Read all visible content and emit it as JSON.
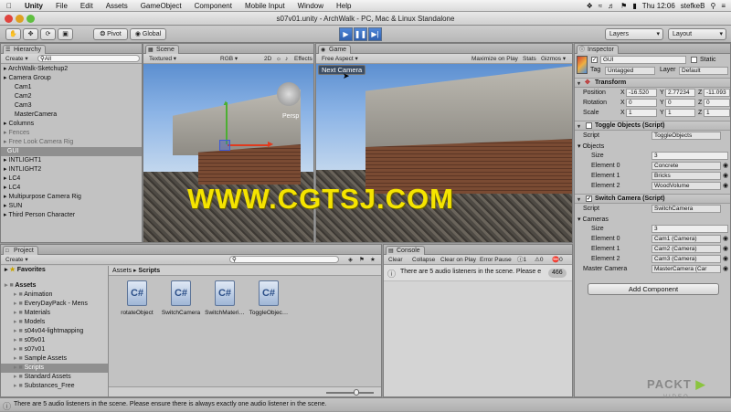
{
  "menubar": {
    "app": "Unity",
    "items": [
      "File",
      "Edit",
      "Assets",
      "GameObject",
      "Component",
      "Mobile Input",
      "Window",
      "Help"
    ],
    "clock": "Thu 12:06",
    "user": "stefkeB"
  },
  "window": {
    "title": "s07v01.unity - ArchWalk - PC, Mac & Linux Standalone"
  },
  "toolbar": {
    "pivot": "Pivot",
    "global": "Global",
    "layers": "Layers",
    "layout": "Layout"
  },
  "hierarchy": {
    "tab": "Hierarchy",
    "create": "Create",
    "search_all": "All",
    "items": [
      {
        "label": "ArchWalk-Sketchup2",
        "indent": 0,
        "arrow": true,
        "state": "normal"
      },
      {
        "label": "Camera Group",
        "indent": 0,
        "arrow": true,
        "state": "normal"
      },
      {
        "label": "Cam1",
        "indent": 1,
        "arrow": false,
        "state": "normal"
      },
      {
        "label": "Cam2",
        "indent": 1,
        "arrow": false,
        "state": "normal"
      },
      {
        "label": "Cam3",
        "indent": 1,
        "arrow": false,
        "state": "normal"
      },
      {
        "label": "MasterCamera",
        "indent": 1,
        "arrow": false,
        "state": "normal"
      },
      {
        "label": "Columns",
        "indent": 0,
        "arrow": true,
        "state": "normal"
      },
      {
        "label": "Fences",
        "indent": 0,
        "arrow": true,
        "state": "muted"
      },
      {
        "label": "Free Look Camera Rig",
        "indent": 0,
        "arrow": true,
        "state": "muted"
      },
      {
        "label": "GUI",
        "indent": 0,
        "arrow": false,
        "state": "selected"
      },
      {
        "label": "INTLIGHT1",
        "indent": 0,
        "arrow": true,
        "state": "normal"
      },
      {
        "label": "INTLIGHT2",
        "indent": 0,
        "arrow": true,
        "state": "normal"
      },
      {
        "label": "LC4",
        "indent": 0,
        "arrow": true,
        "state": "normal"
      },
      {
        "label": "LC4",
        "indent": 0,
        "arrow": true,
        "state": "normal"
      },
      {
        "label": "Multipurpose Camera Rig",
        "indent": 0,
        "arrow": true,
        "state": "normal"
      },
      {
        "label": "SUN",
        "indent": 0,
        "arrow": true,
        "state": "normal"
      },
      {
        "label": "Third Person Character",
        "indent": 0,
        "arrow": true,
        "state": "normal"
      }
    ]
  },
  "scene": {
    "tab": "Scene",
    "shading": "Textured",
    "render": "RGB",
    "mode2d": "2D",
    "effects": "Effects",
    "persp": "Persp"
  },
  "game": {
    "tab": "Game",
    "aspect": "Free Aspect",
    "maximize": "Maximize on Play",
    "stats": "Stats",
    "gizmos": "Gizmos",
    "button": "Next Camera"
  },
  "watermark": "WWW.CGTSJ.COM",
  "inspector": {
    "tab": "Inspector",
    "object_name": "GUI",
    "static": "Static",
    "tag_label": "Tag",
    "tag": "Untagged",
    "layer_label": "Layer",
    "layer": "Default",
    "transform": {
      "title": "Transform",
      "position": {
        "label": "Position",
        "x": "-16.520",
        "y": "2.77234",
        "z": "-11.093"
      },
      "rotation": {
        "label": "Rotation",
        "x": "0",
        "y": "0",
        "z": "0"
      },
      "scale": {
        "label": "Scale",
        "x": "1",
        "y": "1",
        "z": "1"
      }
    },
    "toggle": {
      "title": "Toggle Objects (Script)",
      "script_label": "Script",
      "script": "ToggleObjects",
      "list_label": "Objects",
      "size_label": "Size",
      "size": "3",
      "elements": [
        {
          "label": "Element 0",
          "value": "Concrete"
        },
        {
          "label": "Element 1",
          "value": "Bricks"
        },
        {
          "label": "Element 2",
          "value": "WoodVolume"
        }
      ]
    },
    "switch": {
      "title": "Switch Camera (Script)",
      "script_label": "Script",
      "script": "SwitchCamera",
      "list_label": "Cameras",
      "size_label": "Size",
      "size": "3",
      "elements": [
        {
          "label": "Element 0",
          "value": "Cam1 (Camera)"
        },
        {
          "label": "Element 1",
          "value": "Cam2 (Camera)"
        },
        {
          "label": "Element 2",
          "value": "Cam3 (Camera)"
        }
      ],
      "master_label": "Master Camera",
      "master": "MasterCamera (Car"
    },
    "add_component": "Add Component"
  },
  "project": {
    "tab": "Project",
    "create": "Create",
    "favorites": "Favorites",
    "breadcrumb": [
      "Assets",
      "Scripts"
    ],
    "tree": [
      {
        "label": "Assets",
        "indent": 0,
        "bold": true,
        "state": "normal"
      },
      {
        "label": "Animation",
        "indent": 1,
        "bold": false,
        "state": "normal"
      },
      {
        "label": "EveryDayPack - Mens",
        "indent": 1,
        "bold": false,
        "state": "normal"
      },
      {
        "label": "Materials",
        "indent": 1,
        "bold": false,
        "state": "normal"
      },
      {
        "label": "Models",
        "indent": 1,
        "bold": false,
        "state": "normal"
      },
      {
        "label": "s04v04-lightmapping",
        "indent": 1,
        "bold": false,
        "state": "normal"
      },
      {
        "label": "s05v01",
        "indent": 1,
        "bold": false,
        "state": "normal"
      },
      {
        "label": "s07v01",
        "indent": 1,
        "bold": false,
        "state": "normal"
      },
      {
        "label": "Sample Assets",
        "indent": 1,
        "bold": false,
        "state": "normal"
      },
      {
        "label": "Scripts",
        "indent": 1,
        "bold": false,
        "state": "selected"
      },
      {
        "label": "Standard Assets",
        "indent": 1,
        "bold": false,
        "state": "normal"
      },
      {
        "label": "Substances_Free",
        "indent": 1,
        "bold": false,
        "state": "normal"
      }
    ],
    "assets": [
      {
        "label": "rotateObject",
        "glyph": "C#"
      },
      {
        "label": "SwitchCamera",
        "glyph": "C#"
      },
      {
        "label": "SwitchMateri…",
        "glyph": "C#"
      },
      {
        "label": "ToggleObjec…",
        "glyph": "C#"
      }
    ]
  },
  "console": {
    "tab": "Console",
    "clear": "Clear",
    "collapse": "Collapse",
    "clear_on_play": "Clear on Play",
    "error_pause": "Error Pause",
    "count_log": "1",
    "count_warn": "0",
    "count_err": "0",
    "message": "There are 5 audio listeners in the scene. Please e",
    "badge": "466"
  },
  "statusbar": {
    "message": "There are 5 audio listeners in the scene. Please ensure there is always exactly one audio listener in the scene."
  },
  "logo": {
    "text": "PACKT",
    "sub": "VIDEO"
  },
  "colors": {
    "accent": "#3b6fd4",
    "selection": "#8f8f8f",
    "watermark": "#f5e400"
  }
}
